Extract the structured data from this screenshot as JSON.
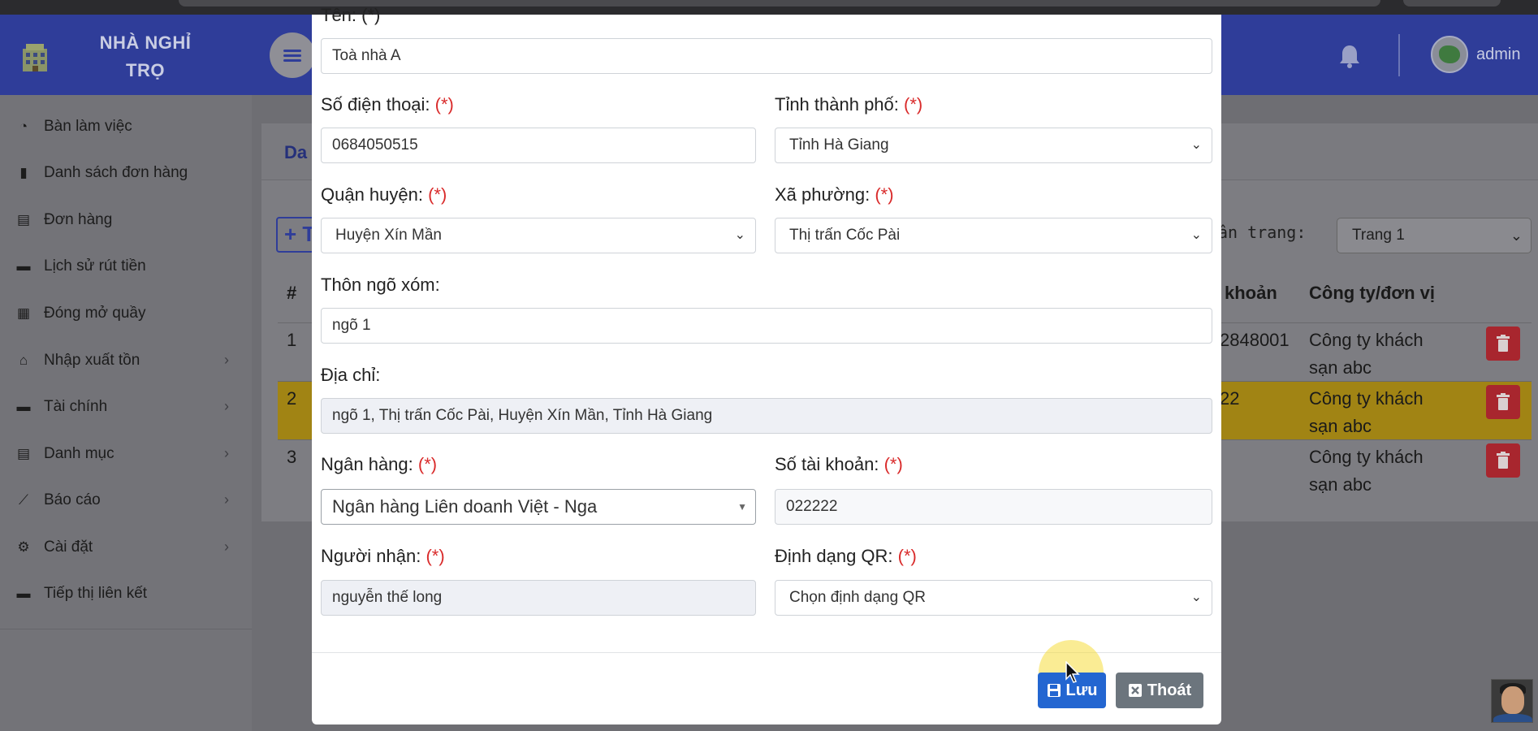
{
  "brand": {
    "line1": "NHÀ NGHỈ",
    "line2": "TRỌ"
  },
  "header": {
    "user": "admin"
  },
  "sidebar": {
    "items": [
      {
        "label": "Bàn làm việc",
        "icon": "gauge-icon",
        "has_submenu": false
      },
      {
        "label": "Danh sách đơn hàng",
        "icon": "book-icon",
        "has_submenu": false
      },
      {
        "label": "Đơn hàng",
        "icon": "clipboard-icon",
        "has_submenu": false
      },
      {
        "label": "Lịch sử rút tiền",
        "icon": "wallet-icon",
        "has_submenu": false
      },
      {
        "label": "Đóng mở quầy",
        "icon": "cash-register-icon",
        "has_submenu": false
      },
      {
        "label": "Nhập xuất tồn",
        "icon": "warehouse-icon",
        "has_submenu": true
      },
      {
        "label": "Tài chính",
        "icon": "wallet-icon",
        "has_submenu": true
      },
      {
        "label": "Danh mục",
        "icon": "clipboard-icon",
        "has_submenu": true
      },
      {
        "label": "Báo cáo",
        "icon": "chart-line-icon",
        "has_submenu": true
      },
      {
        "label": "Cài đặt",
        "icon": "cogs-icon",
        "has_submenu": true
      },
      {
        "label": "Tiếp thị liên kết",
        "icon": "wallet-icon",
        "has_submenu": false
      }
    ]
  },
  "background": {
    "card_title": "Da",
    "add_button": "+ T",
    "page_label": "ân trang:",
    "page_select": "Trang 1",
    "table": {
      "headers": {
        "index": "#",
        "account": "khoản",
        "company": "Công ty/đơn vị"
      },
      "rows": [
        {
          "index": "1",
          "account": "2848001",
          "company_line1": "Công ty khách",
          "company_line2": "sạn abc",
          "highlighted": false
        },
        {
          "index": "2",
          "account": "22",
          "company_line1": "Công ty khách",
          "company_line2": "sạn abc",
          "highlighted": true
        },
        {
          "index": "3",
          "account": "",
          "company_line1": "Công ty khách",
          "company_line2": "sạn abc",
          "highlighted": false
        }
      ]
    }
  },
  "modal": {
    "name": {
      "label": "Tên: (*)",
      "value": "Toà nhà A"
    },
    "phone": {
      "label": "Số điện thoại:",
      "value": "0684050515"
    },
    "province": {
      "label": "Tỉnh thành phố:",
      "value": "Tỉnh Hà Giang"
    },
    "district": {
      "label": "Quận huyện:",
      "value": "Huyện Xín Mần"
    },
    "ward": {
      "label": "Xã phường:",
      "value": "Thị trấn Cốc Pài"
    },
    "hamlet": {
      "label": "Thôn ngõ xóm:",
      "value": "ngõ 1"
    },
    "address": {
      "label": "Địa chỉ:",
      "value": "ngõ 1, Thị trấn Cốc Pài, Huyện Xín Mần, Tỉnh Hà Giang"
    },
    "bank": {
      "label": "Ngân hàng:",
      "value": "Ngân hàng Liên doanh Việt - Nga"
    },
    "account_no": {
      "label": "Số tài khoản:",
      "value": "022222"
    },
    "recipient": {
      "label": "Người nhận:",
      "value": "nguyễn thế long"
    },
    "qr_format": {
      "label": "Định dạng QR:",
      "value": "Chọn định dạng QR"
    },
    "required_mark": "(*)",
    "save_label": "Lưu",
    "exit_label": "Thoát"
  },
  "colors": {
    "navbar": "#3b4bc4",
    "save_button": "#2366d1",
    "delete_button": "#dc3545",
    "highlight_row": "#c9a600",
    "required": "#d92b2b"
  }
}
